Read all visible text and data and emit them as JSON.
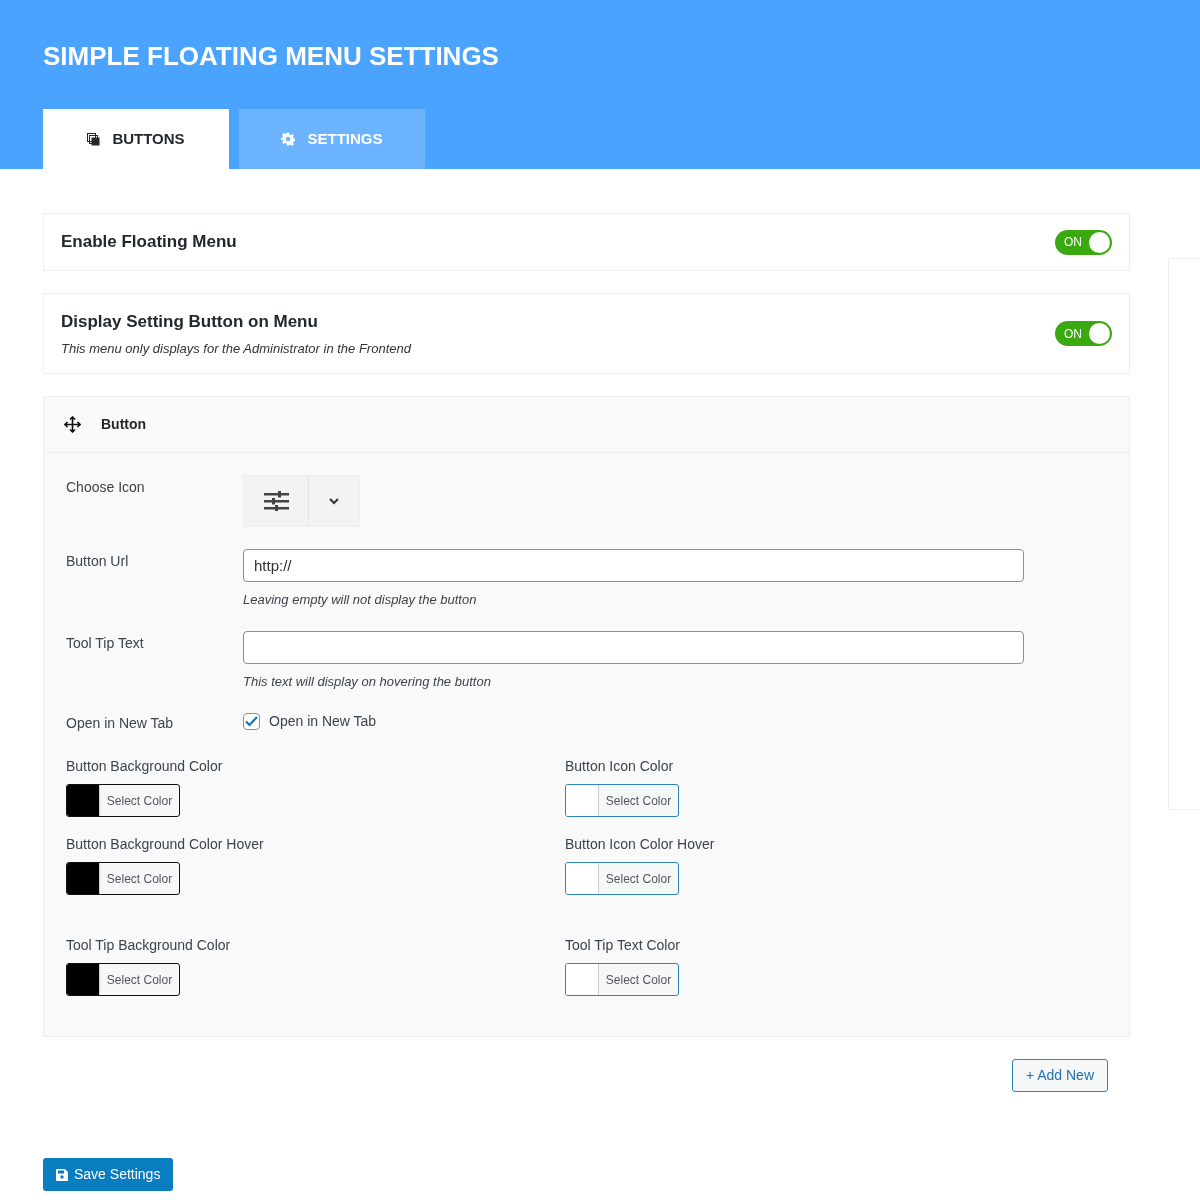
{
  "header": {
    "title": "SIMPLE FLOATING MENU SETTINGS"
  },
  "tabs": [
    {
      "label": "BUTTONS",
      "selected": true
    },
    {
      "label": "SETTINGS",
      "selected": false
    }
  ],
  "toggles": [
    {
      "label": "Enable Floating Menu",
      "on": true,
      "state_label": "ON"
    },
    {
      "label": "Display Setting Button on Menu",
      "description": "This menu only displays for the Administrator in the Frontend",
      "on": true,
      "state_label": "ON"
    }
  ],
  "button_panel": {
    "title": "Button",
    "choose_icon": {
      "label": "Choose Icon"
    },
    "url": {
      "label": "Button Url",
      "value": "http://",
      "help": "Leaving empty will not display the button"
    },
    "tooltip": {
      "label": "Tool Tip Text",
      "help": "This text will display on hovering the button"
    },
    "new_tab": {
      "label": "Open in New Tab",
      "checkbox_label": "Open in New Tab",
      "checked": true
    },
    "colors": [
      {
        "label": "Button Background Color",
        "color": "#000000",
        "button": "Select Color"
      },
      {
        "label": "Button Icon Color",
        "color": "#ffffff",
        "button": "Select Color"
      },
      {
        "label": "Button Background Color Hover",
        "color": "#000000",
        "button": "Select Color"
      },
      {
        "label": "Button Icon Color Hover",
        "color": "#ffffff",
        "button": "Select Color"
      },
      {
        "label": "Tool Tip Background Color",
        "color": "#000000",
        "button": "Select Color"
      },
      {
        "label": "Tool Tip Text Color",
        "color": "#ffffff",
        "button": "Select Color"
      }
    ]
  },
  "add_new": "+ Add New",
  "save": "Save Settings"
}
